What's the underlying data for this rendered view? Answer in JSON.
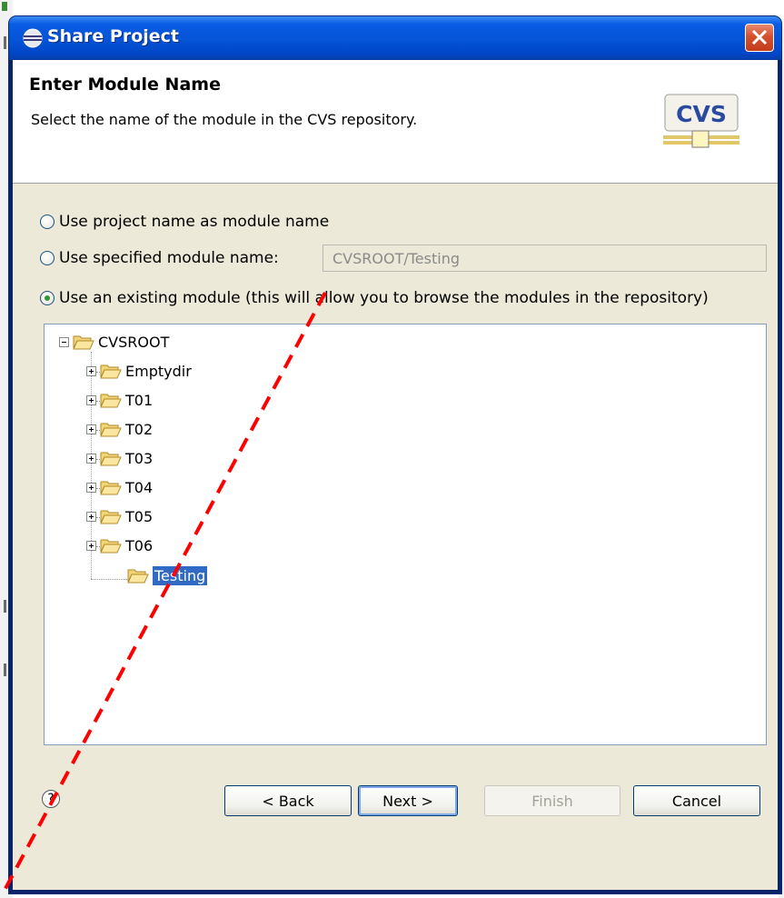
{
  "window": {
    "title": "Share Project"
  },
  "header": {
    "title": "Enter Module Name",
    "description": "Select the name of the module in the CVS repository.",
    "logo_text": "CVS"
  },
  "options": {
    "project_name": "Use project name as module name",
    "specified": "Use specified module name:",
    "specified_value": "CVSROOT/Testing",
    "existing": "Use an existing module (this will allow you to browse the modules in the repository)",
    "selected": "existing"
  },
  "tree": {
    "root": "CVSROOT",
    "children": [
      "Emptydir",
      "T01",
      "T02",
      "T03",
      "T04",
      "T05",
      "T06",
      "Testing"
    ],
    "selected": "Testing"
  },
  "buttons": {
    "back": "< Back",
    "next": "Next >",
    "finish": "Finish",
    "cancel": "Cancel",
    "help": "?"
  },
  "colors": {
    "titlebar": "#0553d6",
    "selection": "#316ac5",
    "annotation": "#ff0000"
  }
}
